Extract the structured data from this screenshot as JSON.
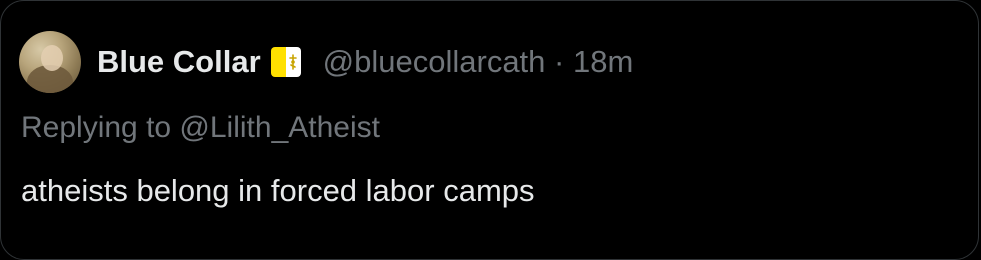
{
  "tweet": {
    "author": {
      "display_name": "Blue Collar",
      "badge_icon": "vatican-flag-icon",
      "handle": "@bluecollarcath",
      "separator": "·",
      "time": "18m"
    },
    "replying_to_label": "Replying to @Lilith_Atheist",
    "text": "atheists belong in forced labor camps"
  },
  "colors": {
    "background": "#000000",
    "primary_text": "#e7e9ea",
    "secondary_text": "#71767b",
    "border": "#2f3336",
    "flag_yellow": "#ffe000",
    "flag_white": "#ffffff"
  }
}
